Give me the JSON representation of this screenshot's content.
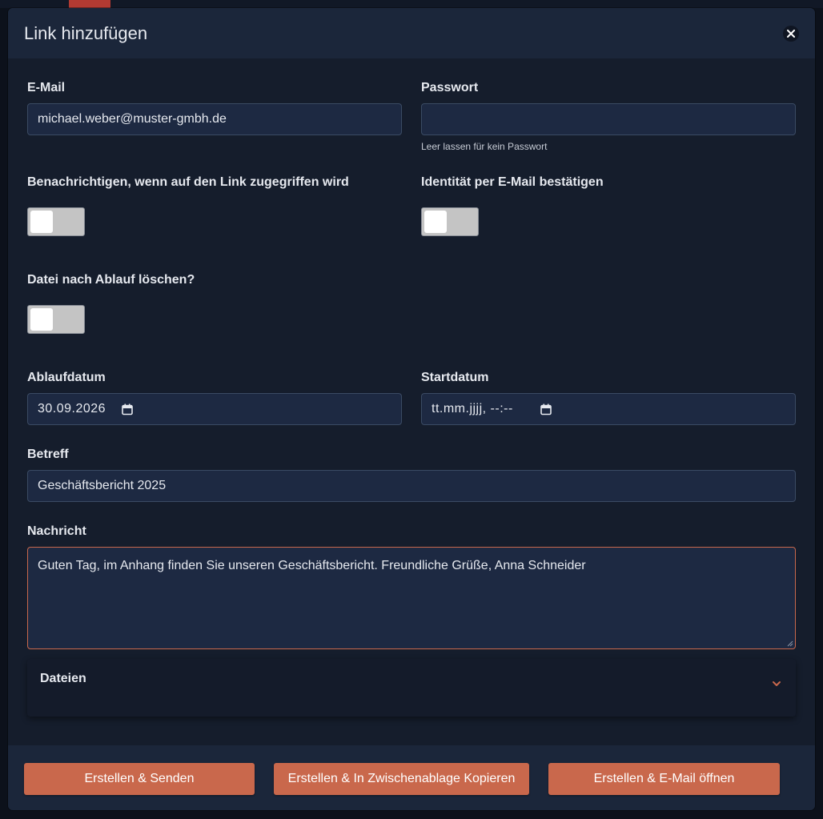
{
  "modal": {
    "title": "Link hinzufügen",
    "close_icon": "close-icon"
  },
  "form": {
    "email": {
      "label": "E-Mail",
      "value": "michael.weber@muster-gmbh.de"
    },
    "password": {
      "label": "Passwort",
      "value": "",
      "hint": "Leer lassen für kein Passwort"
    },
    "notify_on_access": {
      "label": "Benachrichtigen, wenn auf den Link zugegriffen wird",
      "checked": false
    },
    "verify_identity": {
      "label": "Identität per E-Mail bestätigen",
      "checked": false
    },
    "delete_after_expiry": {
      "label": "Datei nach Ablauf löschen?",
      "checked": false
    },
    "expiry_date": {
      "label": "Ablaufdatum",
      "value": "30.09.2026"
    },
    "start_date": {
      "label": "Startdatum",
      "value": "tt.mm.jjjj, --:--"
    },
    "subject": {
      "label": "Betreff",
      "value": "Geschäftsbericht 2025"
    },
    "message": {
      "label": "Nachricht",
      "value": "Guten Tag, im Anhang finden Sie unseren Geschäftsbericht. Freundliche Grüße, Anna Schneider"
    }
  },
  "files_section": {
    "label": "Dateien",
    "icon": "chevron-down-icon"
  },
  "footer": {
    "create_send": "Erstellen & Senden",
    "create_copy": "Erstellen & In Zwischenablage Kopieren",
    "create_open_email": "Erstellen & E-Mail öffnen"
  },
  "colors": {
    "accent": "#c9684c",
    "modal_bg": "#151d2c",
    "header_bg": "#1b263a",
    "input_bg": "#1d2942"
  }
}
